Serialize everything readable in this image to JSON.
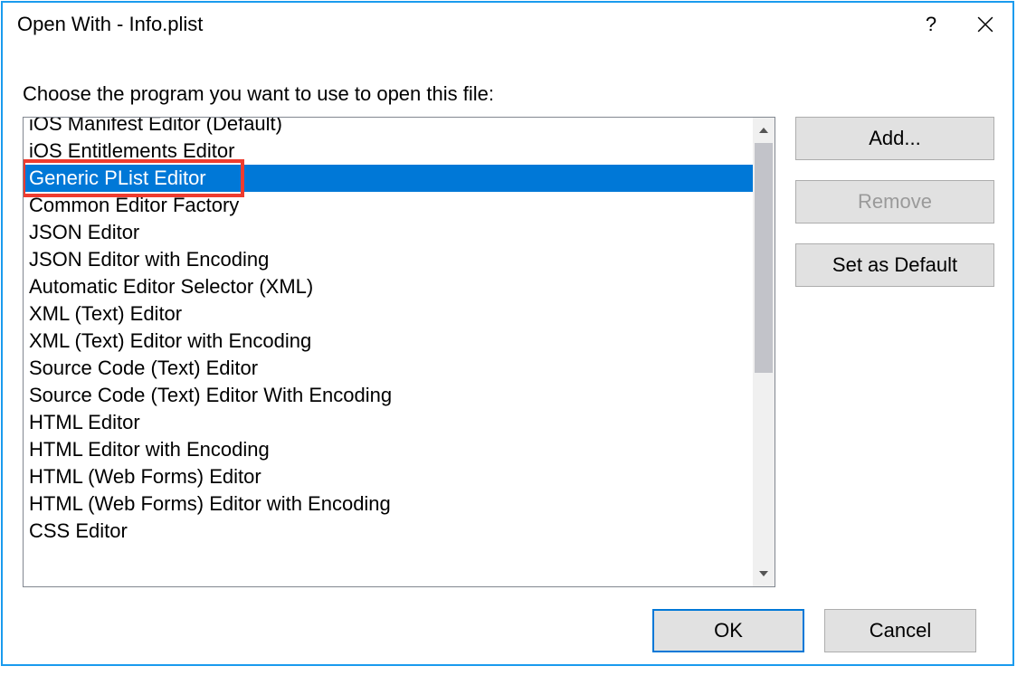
{
  "window": {
    "title": "Open With - Info.plist"
  },
  "instruction": "Choose the program you want to use to open this file:",
  "list": {
    "items": [
      "iOS Manifest Editor (Default)",
      "iOS Entitlements Editor",
      "Generic PList Editor",
      "Common Editor Factory",
      "JSON Editor",
      "JSON Editor with Encoding",
      "Automatic Editor Selector (XML)",
      "XML (Text) Editor",
      "XML (Text) Editor with Encoding",
      "Source Code (Text) Editor",
      "Source Code (Text) Editor With Encoding",
      "HTML Editor",
      "HTML Editor with Encoding",
      "HTML (Web Forms) Editor",
      "HTML (Web Forms) Editor with Encoding",
      "CSS Editor"
    ],
    "selected_index": 2,
    "highlighted_index": 2
  },
  "buttons": {
    "add": "Add...",
    "remove": "Remove",
    "set_default": "Set as Default",
    "ok": "OK",
    "cancel": "Cancel"
  },
  "titlebar": {
    "help": "?",
    "close": "✕"
  }
}
